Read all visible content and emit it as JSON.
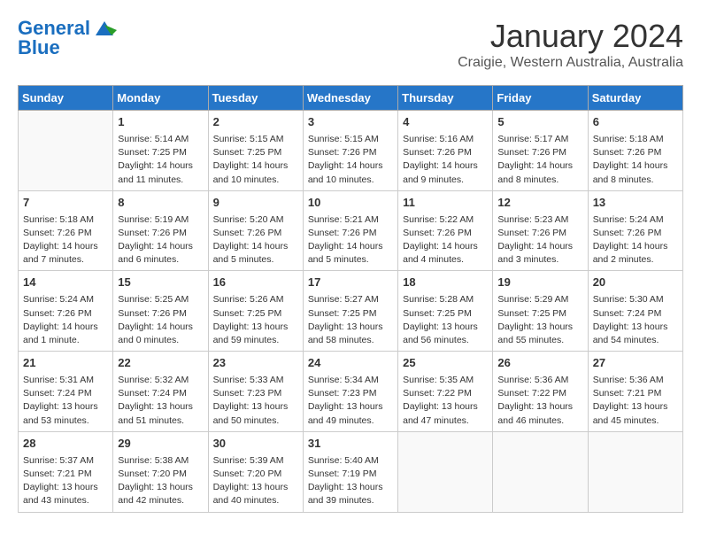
{
  "logo": {
    "line1": "General",
    "line2": "Blue"
  },
  "title": "January 2024",
  "subtitle": "Craigie, Western Australia, Australia",
  "days_header": [
    "Sunday",
    "Monday",
    "Tuesday",
    "Wednesday",
    "Thursday",
    "Friday",
    "Saturday"
  ],
  "weeks": [
    [
      {
        "day": "",
        "content": ""
      },
      {
        "day": "1",
        "content": "Sunrise: 5:14 AM\nSunset: 7:25 PM\nDaylight: 14 hours\nand 11 minutes."
      },
      {
        "day": "2",
        "content": "Sunrise: 5:15 AM\nSunset: 7:25 PM\nDaylight: 14 hours\nand 10 minutes."
      },
      {
        "day": "3",
        "content": "Sunrise: 5:15 AM\nSunset: 7:26 PM\nDaylight: 14 hours\nand 10 minutes."
      },
      {
        "day": "4",
        "content": "Sunrise: 5:16 AM\nSunset: 7:26 PM\nDaylight: 14 hours\nand 9 minutes."
      },
      {
        "day": "5",
        "content": "Sunrise: 5:17 AM\nSunset: 7:26 PM\nDaylight: 14 hours\nand 8 minutes."
      },
      {
        "day": "6",
        "content": "Sunrise: 5:18 AM\nSunset: 7:26 PM\nDaylight: 14 hours\nand 8 minutes."
      }
    ],
    [
      {
        "day": "7",
        "content": "Sunrise: 5:18 AM\nSunset: 7:26 PM\nDaylight: 14 hours\nand 7 minutes."
      },
      {
        "day": "8",
        "content": "Sunrise: 5:19 AM\nSunset: 7:26 PM\nDaylight: 14 hours\nand 6 minutes."
      },
      {
        "day": "9",
        "content": "Sunrise: 5:20 AM\nSunset: 7:26 PM\nDaylight: 14 hours\nand 5 minutes."
      },
      {
        "day": "10",
        "content": "Sunrise: 5:21 AM\nSunset: 7:26 PM\nDaylight: 14 hours\nand 5 minutes."
      },
      {
        "day": "11",
        "content": "Sunrise: 5:22 AM\nSunset: 7:26 PM\nDaylight: 14 hours\nand 4 minutes."
      },
      {
        "day": "12",
        "content": "Sunrise: 5:23 AM\nSunset: 7:26 PM\nDaylight: 14 hours\nand 3 minutes."
      },
      {
        "day": "13",
        "content": "Sunrise: 5:24 AM\nSunset: 7:26 PM\nDaylight: 14 hours\nand 2 minutes."
      }
    ],
    [
      {
        "day": "14",
        "content": "Sunrise: 5:24 AM\nSunset: 7:26 PM\nDaylight: 14 hours\nand 1 minute."
      },
      {
        "day": "15",
        "content": "Sunrise: 5:25 AM\nSunset: 7:26 PM\nDaylight: 14 hours\nand 0 minutes."
      },
      {
        "day": "16",
        "content": "Sunrise: 5:26 AM\nSunset: 7:25 PM\nDaylight: 13 hours\nand 59 minutes."
      },
      {
        "day": "17",
        "content": "Sunrise: 5:27 AM\nSunset: 7:25 PM\nDaylight: 13 hours\nand 58 minutes."
      },
      {
        "day": "18",
        "content": "Sunrise: 5:28 AM\nSunset: 7:25 PM\nDaylight: 13 hours\nand 56 minutes."
      },
      {
        "day": "19",
        "content": "Sunrise: 5:29 AM\nSunset: 7:25 PM\nDaylight: 13 hours\nand 55 minutes."
      },
      {
        "day": "20",
        "content": "Sunrise: 5:30 AM\nSunset: 7:24 PM\nDaylight: 13 hours\nand 54 minutes."
      }
    ],
    [
      {
        "day": "21",
        "content": "Sunrise: 5:31 AM\nSunset: 7:24 PM\nDaylight: 13 hours\nand 53 minutes."
      },
      {
        "day": "22",
        "content": "Sunrise: 5:32 AM\nSunset: 7:24 PM\nDaylight: 13 hours\nand 51 minutes."
      },
      {
        "day": "23",
        "content": "Sunrise: 5:33 AM\nSunset: 7:23 PM\nDaylight: 13 hours\nand 50 minutes."
      },
      {
        "day": "24",
        "content": "Sunrise: 5:34 AM\nSunset: 7:23 PM\nDaylight: 13 hours\nand 49 minutes."
      },
      {
        "day": "25",
        "content": "Sunrise: 5:35 AM\nSunset: 7:22 PM\nDaylight: 13 hours\nand 47 minutes."
      },
      {
        "day": "26",
        "content": "Sunrise: 5:36 AM\nSunset: 7:22 PM\nDaylight: 13 hours\nand 46 minutes."
      },
      {
        "day": "27",
        "content": "Sunrise: 5:36 AM\nSunset: 7:21 PM\nDaylight: 13 hours\nand 45 minutes."
      }
    ],
    [
      {
        "day": "28",
        "content": "Sunrise: 5:37 AM\nSunset: 7:21 PM\nDaylight: 13 hours\nand 43 minutes."
      },
      {
        "day": "29",
        "content": "Sunrise: 5:38 AM\nSunset: 7:20 PM\nDaylight: 13 hours\nand 42 minutes."
      },
      {
        "day": "30",
        "content": "Sunrise: 5:39 AM\nSunset: 7:20 PM\nDaylight: 13 hours\nand 40 minutes."
      },
      {
        "day": "31",
        "content": "Sunrise: 5:40 AM\nSunset: 7:19 PM\nDaylight: 13 hours\nand 39 minutes."
      },
      {
        "day": "",
        "content": ""
      },
      {
        "day": "",
        "content": ""
      },
      {
        "day": "",
        "content": ""
      }
    ]
  ]
}
